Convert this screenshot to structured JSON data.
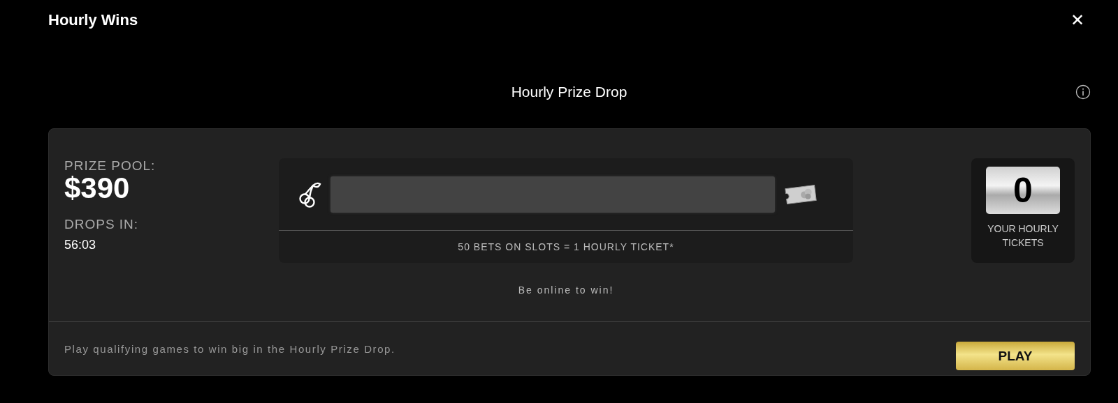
{
  "window": {
    "title": "Hourly Wins",
    "close": "✕"
  },
  "heading": "Hourly Prize Drop",
  "prize": {
    "pool_label": "PRIZE POOL:",
    "pool_value": "$390",
    "drops_label": "DROPS IN:",
    "drops_value": "56:03"
  },
  "progress": {
    "level": 0,
    "caption": "50 BETS ON SLOTS = 1 HOURLY TICKET*"
  },
  "tickets": {
    "count": "0",
    "label": "YOUR HOURLY TICKETS"
  },
  "note": "Be online to win!",
  "footer": {
    "text": "Play qualifying games to win big in the Hourly Prize Drop.",
    "button": "PLAY"
  }
}
